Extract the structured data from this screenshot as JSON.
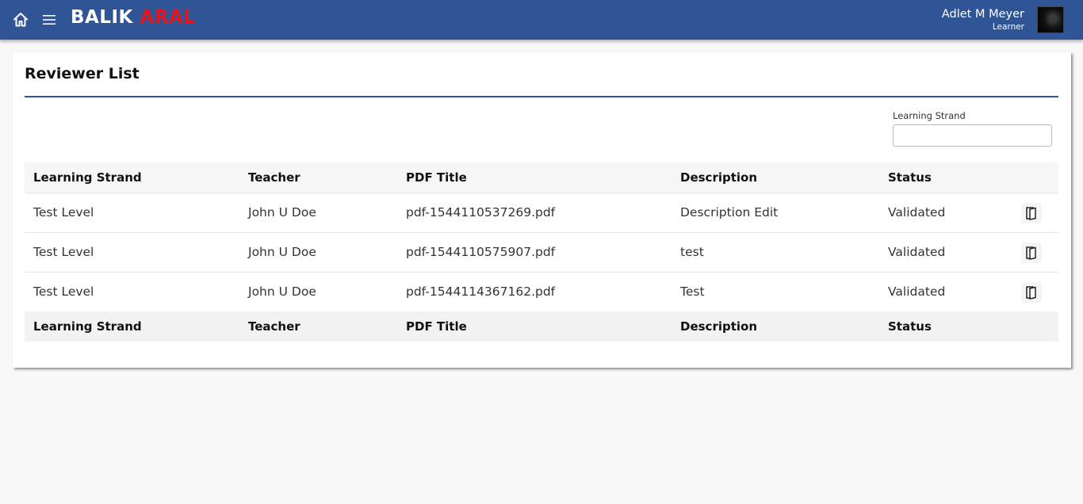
{
  "header": {
    "brand_part1": "BALIK",
    "brand_part2": "ARAL",
    "user_name": "Adlet M Meyer",
    "user_role": "Learner",
    "icons": [
      "home-icon",
      "menu-icon"
    ],
    "colors": {
      "bar": "#2f5597",
      "brand_accent": "#e8141c"
    }
  },
  "page": {
    "title": "Reviewer List"
  },
  "filter": {
    "label": "Learning Strand",
    "value": ""
  },
  "table": {
    "columns": [
      "Learning Strand",
      "Teacher",
      "PDF Title",
      "Description",
      "Status"
    ],
    "rows": [
      {
        "strand": "Test Level",
        "teacher": "John U Doe",
        "pdf": "pdf-1544110537269.pdf",
        "description": "Description Edit",
        "status": "Validated"
      },
      {
        "strand": "Test Level",
        "teacher": "John U Doe",
        "pdf": "pdf-1544110575907.pdf",
        "description": "test",
        "status": "Validated"
      },
      {
        "strand": "Test Level",
        "teacher": "John U Doe",
        "pdf": "pdf-1544114367162.pdf",
        "description": "Test",
        "status": "Validated"
      }
    ],
    "row_action_icon": "book-open-icon"
  }
}
